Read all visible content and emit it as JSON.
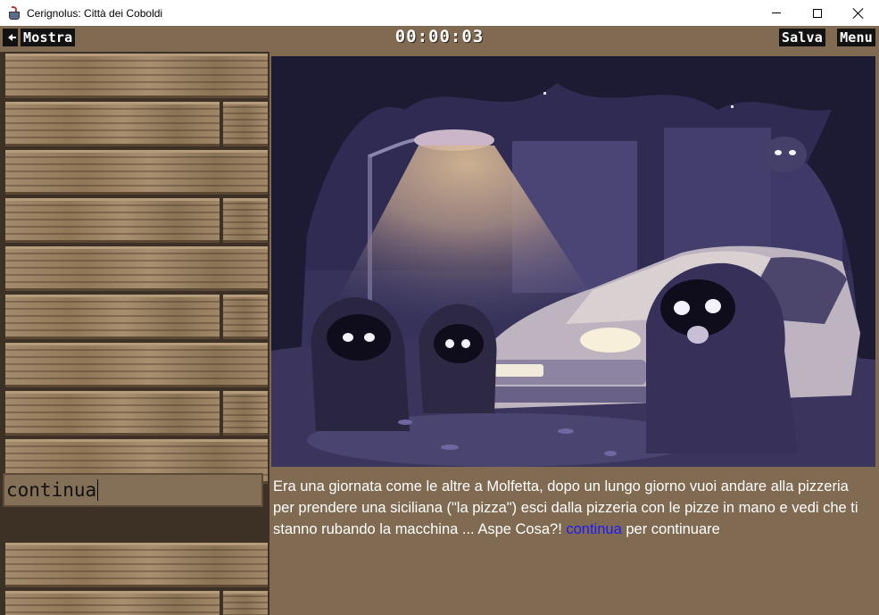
{
  "window": {
    "title": "Cerignolus: Città dei Coboldi"
  },
  "toolbar": {
    "mostra_label": "Mostra",
    "timer": "00:00:03",
    "salva_label": "Salva",
    "menu_label": "Menu"
  },
  "command": {
    "value": "continua"
  },
  "story": {
    "text_before": "Era una giornata come le altre a Molfetta, dopo un lungo giorno vuoi andare alla pizzeria per prendere una siciliana (\"la pizza\") esci dalla pizzeria con le pizze in mano e vedi che ti stanno rubando la macchina ... Aspe Cosa?! ",
    "link_text": "continua",
    "text_after": " per continuare"
  },
  "colors": {
    "background_brown": "#806a51",
    "button_black": "#121212",
    "link_blue": "#1a1aff"
  },
  "icons": {
    "back": "back-arrow-icon",
    "app": "java-cup-icon"
  }
}
